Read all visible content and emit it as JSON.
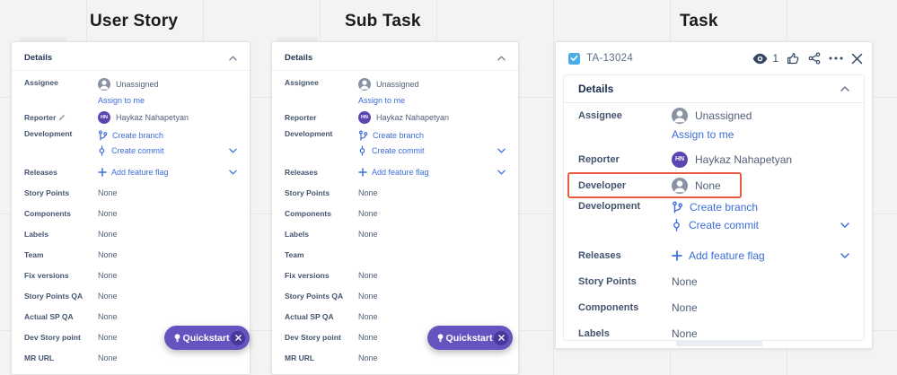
{
  "columns": [
    {
      "title": "User Story"
    },
    {
      "title": "Sub Task"
    },
    {
      "title": "Task"
    }
  ],
  "quickstart": {
    "label": "Quickstart"
  },
  "colors": {
    "link_blue": "#3C6DD9",
    "brand_purple": "#6554C0",
    "avatar_purple": "#5B45B0",
    "highlight_red": "#E8593F",
    "task_icon_blue": "#4BADE8",
    "icon_navy": "#344563"
  },
  "panels": [
    {
      "title": "User Story",
      "details_label": "Details",
      "assignee": {
        "label": "Assignee",
        "value": "Unassigned",
        "link": "Assign to me"
      },
      "reporter": {
        "label": "Reporter",
        "initials": "HN",
        "value": "Haykaz Nahapetyan"
      },
      "development": {
        "label": "Development",
        "branch_link": "Create branch",
        "commit_link": "Create commit"
      },
      "releases": {
        "label": "Releases",
        "flag_link": "Add feature flag"
      },
      "plain_rows": [
        {
          "label": "Story Points",
          "value": "None"
        },
        {
          "label": "Components",
          "value": "None"
        },
        {
          "label": "Labels",
          "value": "None"
        },
        {
          "label": "Team",
          "value": "None"
        },
        {
          "label": "Fix versions",
          "value": "None"
        },
        {
          "label": "Story Points QA",
          "value": "None"
        },
        {
          "label": "Actual SP QA",
          "value": "None"
        },
        {
          "label": "Dev Story point",
          "value": "None"
        },
        {
          "label": "MR URL",
          "value": "None"
        }
      ]
    },
    {
      "title": "Sub Task",
      "details_label": "Details",
      "assignee": {
        "label": "Assignee",
        "value": "Unassigned",
        "link": "Assign to me"
      },
      "reporter": {
        "label": "Reporter",
        "initials": "HN",
        "value": "Haykaz Nahapetyan"
      },
      "development": {
        "label": "Development",
        "branch_link": "Create branch",
        "commit_link": "Create commit"
      },
      "releases": {
        "label": "Releases",
        "flag_link": "Add feature flag"
      },
      "plain_rows": [
        {
          "label": "Story Points",
          "value": "None"
        },
        {
          "label": "Components",
          "value": "None"
        },
        {
          "label": "Labels",
          "value": "None"
        },
        {
          "label": "Team",
          "value": ""
        },
        {
          "label": "Fix versions",
          "value": "None"
        },
        {
          "label": "Story Points QA",
          "value": "None"
        },
        {
          "label": "Actual SP QA",
          "value": "None"
        },
        {
          "label": "Dev Story point",
          "value": "None"
        },
        {
          "label": "MR URL",
          "value": "None"
        }
      ]
    },
    {
      "title": "Task",
      "key": "TA-13024",
      "watchers_count": "1",
      "details_label": "Details",
      "assignee": {
        "label": "Assignee",
        "value": "Unassigned",
        "link": "Assign to me"
      },
      "reporter": {
        "label": "Reporter",
        "initials": "HN",
        "value": "Haykaz Nahapetyan"
      },
      "developer": {
        "label": "Developer",
        "value": "None"
      },
      "development": {
        "label": "Development",
        "branch_link": "Create branch",
        "commit_link": "Create commit"
      },
      "releases": {
        "label": "Releases",
        "flag_link": "Add feature flag"
      },
      "plain_rows": [
        {
          "label": "Story Points",
          "value": "None"
        },
        {
          "label": "Components",
          "value": "None"
        },
        {
          "label": "Labels",
          "value": "None"
        }
      ]
    }
  ]
}
